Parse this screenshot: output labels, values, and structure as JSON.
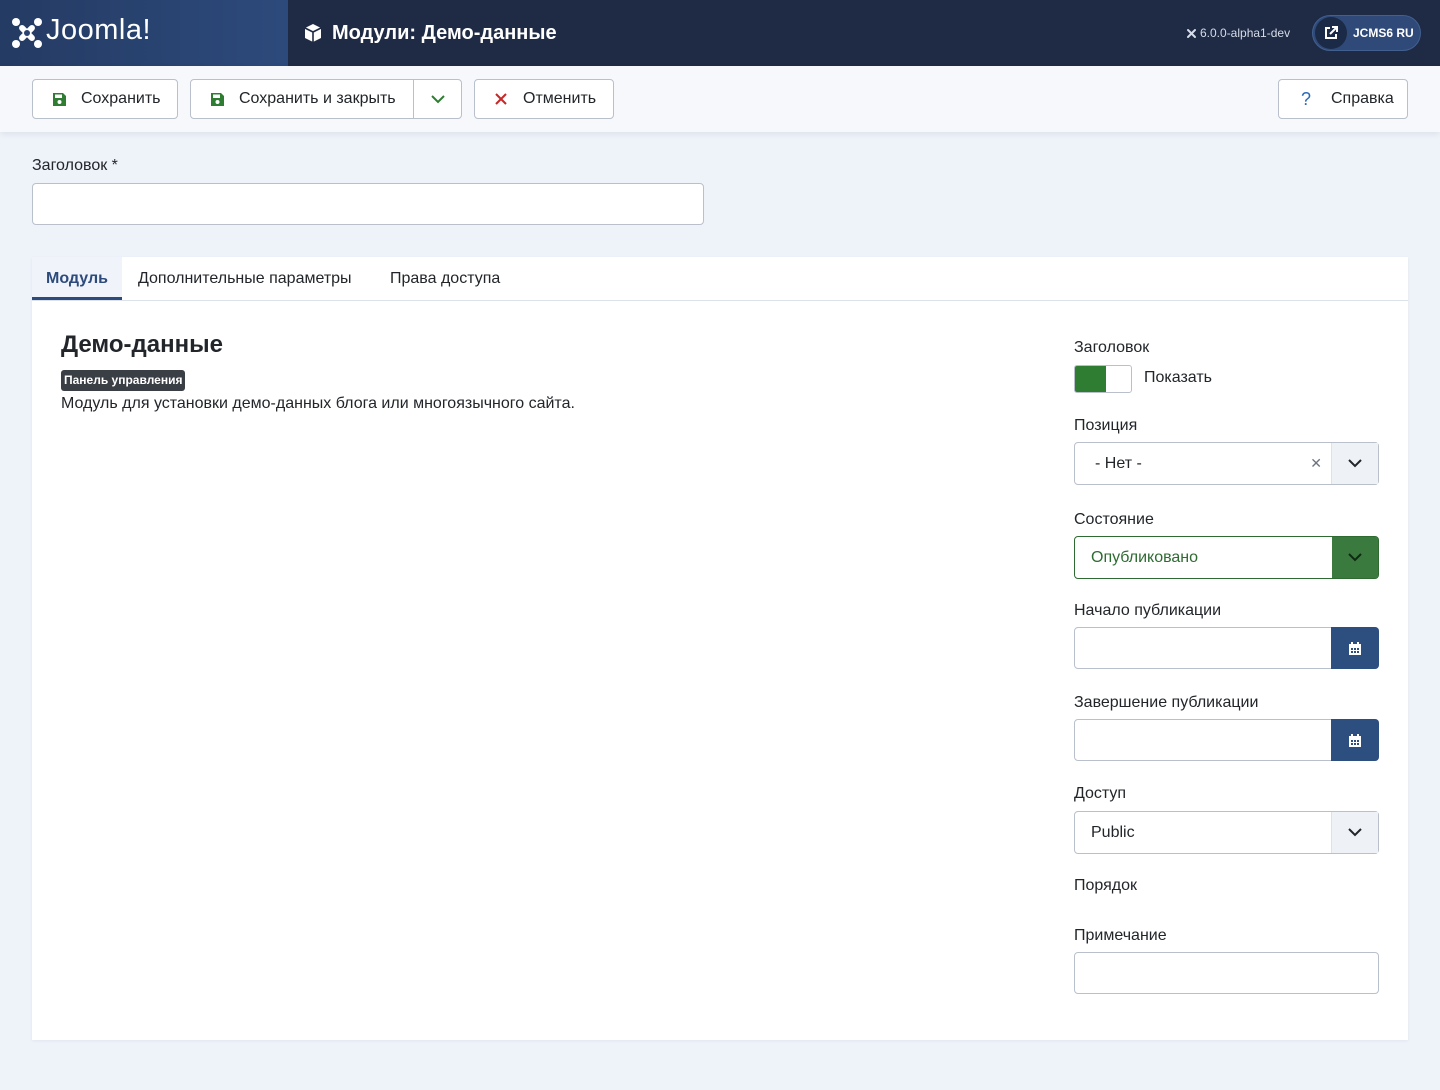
{
  "header": {
    "logo_text": "Joomla!",
    "page_title": "Модули: Демо-данные",
    "version": "6.0.0-alpha1-dev",
    "site_button": "JCMS6 RU"
  },
  "toolbar": {
    "save": "Сохранить",
    "save_close": "Сохранить и закрыть",
    "cancel": "Отменить",
    "help": "Справка"
  },
  "title_field": {
    "label": "Заголовок *",
    "value": ""
  },
  "tabs": [
    {
      "label": "Модуль",
      "active": true
    },
    {
      "label": "Дополнительные параметры",
      "active": false
    },
    {
      "label": "Права доступа",
      "active": false
    }
  ],
  "module": {
    "title": "Демо-данные",
    "badge": "Панель управления",
    "description": "Модуль для установки демо-данных блога или многоязычного сайта."
  },
  "sidebar": {
    "show_title": {
      "label": "Заголовок",
      "toggle_label": "Показать",
      "on": true
    },
    "position": {
      "label": "Позиция",
      "value": "- Нет -"
    },
    "state": {
      "label": "Состояние",
      "value": "Опубликовано"
    },
    "publish_up": {
      "label": "Начало публикации",
      "value": ""
    },
    "publish_down": {
      "label": "Завершение публикации",
      "value": ""
    },
    "access": {
      "label": "Доступ",
      "value": "Public"
    },
    "ordering": {
      "label": "Порядок"
    },
    "note": {
      "label": "Примечание",
      "value": ""
    }
  },
  "colors": {
    "header_bg": "#1f2a44",
    "accent": "#2d4a7c",
    "published_green": "#2e7d32",
    "cancel_red": "#c62828"
  },
  "icons": {
    "logo": "joomla-logo-icon",
    "page": "cube-icon",
    "version": "joomla-small-icon",
    "site": "external-link-icon",
    "save": "floppy-disk-icon",
    "caret": "chevron-down-icon",
    "cancel": "times-icon",
    "help": "question-icon",
    "calendar": "calendar-icon"
  }
}
